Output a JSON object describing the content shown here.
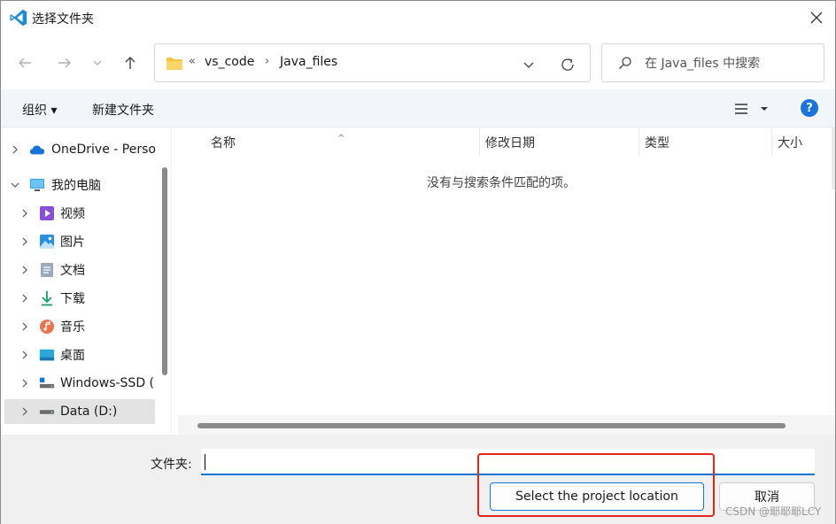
{
  "window": {
    "title": "选择文件夹"
  },
  "nav": {
    "back_icon": "arrow-left-icon",
    "forward_icon": "arrow-right-icon",
    "recent_icon": "chevron-down-icon",
    "up_icon": "arrow-up-icon"
  },
  "address": {
    "overflow": "«",
    "crumbs": [
      "vs_code",
      "Java_files"
    ]
  },
  "search": {
    "placeholder": "在 Java_files 中搜索"
  },
  "toolbar": {
    "organize": "组织 ▾",
    "new_folder": "新建文件夹",
    "help": "?"
  },
  "sidebar": {
    "items": [
      {
        "label": "OneDrive - Perso",
        "icon": "cloud-icon"
      },
      {
        "label": "我的电脑",
        "icon": "monitor-icon"
      },
      {
        "label": "视频",
        "icon": "video-icon"
      },
      {
        "label": "图片",
        "icon": "picture-icon"
      },
      {
        "label": "文档",
        "icon": "document-icon"
      },
      {
        "label": "下载",
        "icon": "download-icon"
      },
      {
        "label": "音乐",
        "icon": "music-icon"
      },
      {
        "label": "桌面",
        "icon": "desktop-icon"
      },
      {
        "label": "Windows-SSD (",
        "icon": "drive-icon"
      },
      {
        "label": "Data (D:)",
        "icon": "drive-icon"
      }
    ]
  },
  "content": {
    "columns": [
      "名称",
      "修改日期",
      "类型",
      "大小"
    ],
    "sort_indicator": "^",
    "empty_message": "没有与搜索条件匹配的项。"
  },
  "footer": {
    "folder_label": "文件夹:",
    "folder_value": "",
    "select_button": "Select the project location",
    "cancel_button": "取消",
    "watermark": "CSDN @耶耶耶LCY"
  },
  "colors": {
    "accent": "#1a73d6",
    "highlight": "#e3241b",
    "toolbar_bg": "#f2f5fa"
  }
}
